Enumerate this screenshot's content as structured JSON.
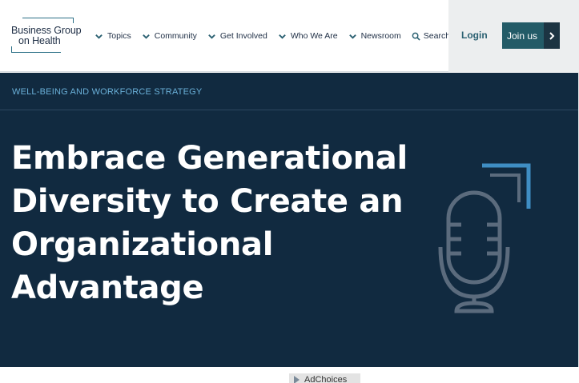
{
  "header": {
    "logo": {
      "line1": "Business Group",
      "line2": "on Health"
    },
    "nav": [
      {
        "label": "Topics",
        "icon": "chevron-down-icon"
      },
      {
        "label": "Community",
        "icon": "chevron-down-icon"
      },
      {
        "label": "Get Involved",
        "icon": "chevron-down-icon"
      },
      {
        "label": "Who We Are",
        "icon": "chevron-down-icon"
      },
      {
        "label": "Newsroom",
        "icon": "chevron-down-icon"
      }
    ],
    "search_label": "Search",
    "login_label": "Login",
    "join_label": "Join us"
  },
  "hero": {
    "eyebrow": "WELL-BEING AND WORKFORCE STRATEGY",
    "title": "Embrace Generational Diversity to Create an Organizational Advantage",
    "icon": "microphone-icon"
  },
  "footer": {
    "adchoices_label": "AdChoices"
  },
  "colors": {
    "hero_bg": "#112a40",
    "eyebrow": "#6ab0d8",
    "accent": "#235b67",
    "mic_stroke": "#5b6b7d",
    "corner_accent": "#3f8ec4"
  }
}
